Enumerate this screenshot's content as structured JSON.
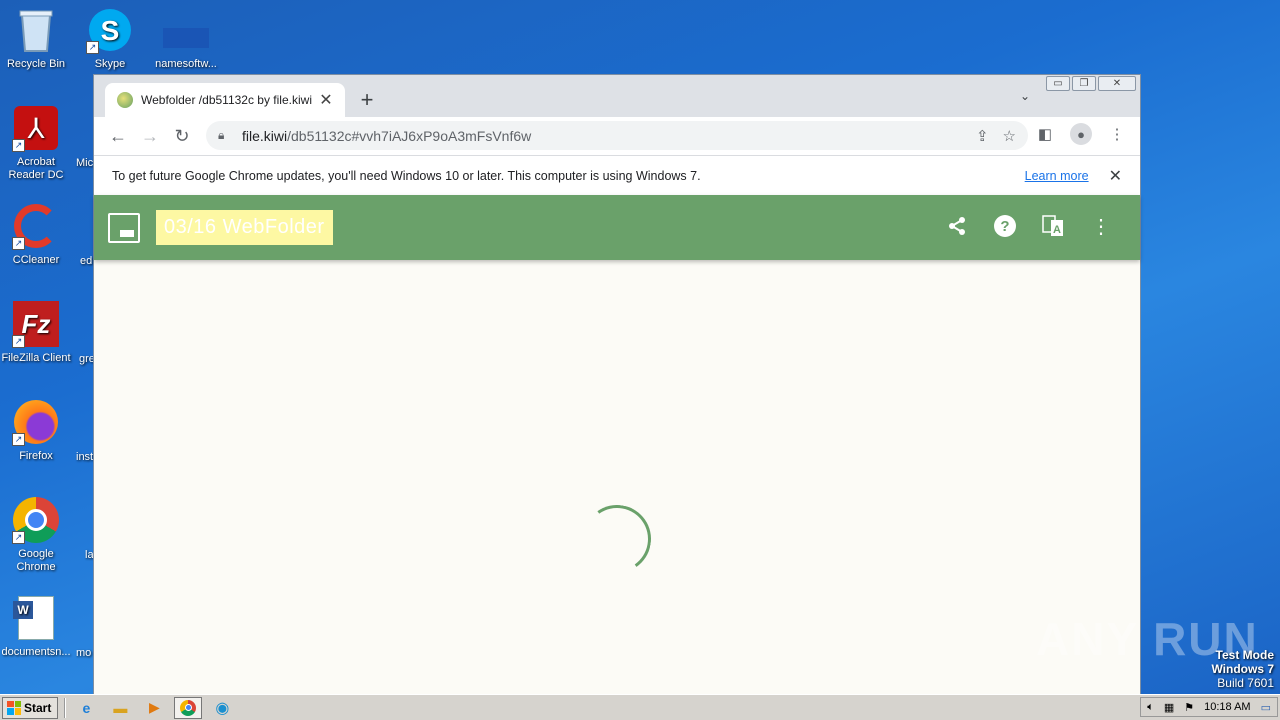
{
  "desktop": {
    "icons": [
      {
        "label": "Recycle Bin"
      },
      {
        "label": "Skype"
      },
      {
        "label": "namesoftw..."
      },
      {
        "label": "Acrobat Reader DC"
      },
      {
        "label": "CCleaner"
      },
      {
        "label": "FileZilla Client"
      },
      {
        "label": "Firefox"
      },
      {
        "label": "Google Chrome"
      },
      {
        "label": "documentsn..."
      }
    ],
    "partial_labels": [
      "Mic",
      "ed",
      "gre",
      "inst",
      "la",
      "mo"
    ]
  },
  "browser": {
    "tab_title": "Webfolder /db51132c by file.kiwi",
    "url_domain": "file.kiwi",
    "url_path": "/db51132c#vvh7iAJ6xP9oA3mFsVnf6w",
    "infobar_message": "To get future Google Chrome updates, you'll need Windows 10 or later. This computer is using Windows 7.",
    "infobar_link": "Learn more"
  },
  "app": {
    "title": "03/16 WebFolder",
    "header_color": "#6aa16a",
    "highlight_color": "#fdf8a3"
  },
  "watermark": "ANY RUN",
  "system": {
    "mode_line1": "Test Mode",
    "mode_line2": "Windows 7",
    "mode_line3": "Build 7601",
    "start_label": "Start",
    "clock": "10:18 AM"
  }
}
